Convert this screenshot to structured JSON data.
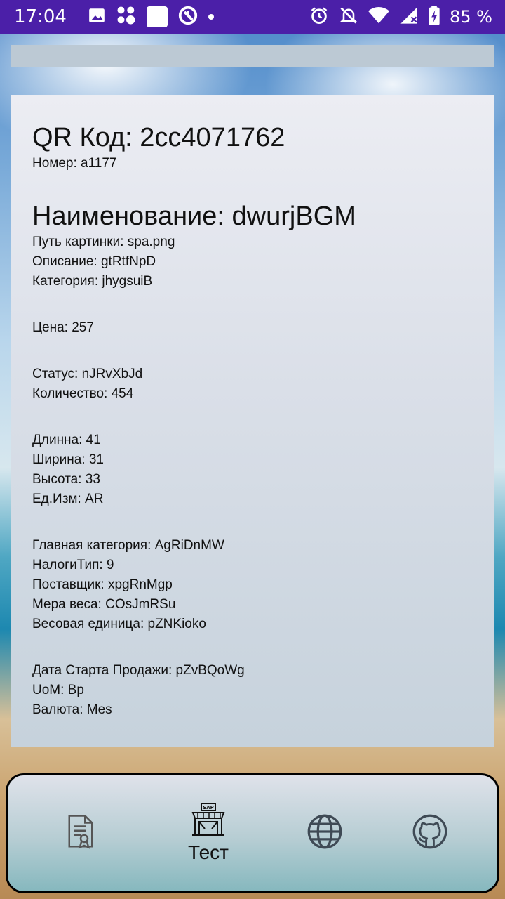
{
  "status_bar": {
    "time": "17:04",
    "battery": "85 %"
  },
  "card": {
    "qr_line": "QR Код: 2cc4071762",
    "number_line": "Номер: a1177",
    "name_line": "Наименование: dwurjBGM",
    "group1": [
      "Путь картинки: spa.png",
      "Описание: gtRtfNpD",
      "Категория: jhygsuiB"
    ],
    "group2": [
      "Цена: 257"
    ],
    "group3": [
      "Статус: nJRvXbJd",
      "Количество: 454"
    ],
    "group4": [
      "Длинна: 41",
      "Ширина: 31",
      "Высота: 33",
      "Ед.Изм: AR"
    ],
    "group5": [
      "Главная категория: AgRiDnMW",
      "НалогиТип: 9",
      "Поставщик: xpgRnMgp",
      "Мера веса: COsJmRSu",
      "Весовая единица: pZNKioko"
    ],
    "group6": [
      "Дата Старта Продажи: pZvBQoWg",
      "UoM: Bp",
      "Валюта: Mes"
    ]
  },
  "nav": {
    "items": [
      {
        "icon": "certificate-document-icon"
      },
      {
        "icon": "sap-store-icon",
        "label": "Тест"
      },
      {
        "icon": "globe-icon"
      },
      {
        "icon": "github-icon"
      }
    ]
  },
  "colors": {
    "status_bar": "#4b1fa8",
    "card_top": "#ecedf3",
    "card_bottom": "#c6d2dc",
    "nav_top": "#dfe2ea",
    "nav_bottom": "#86b8be"
  }
}
